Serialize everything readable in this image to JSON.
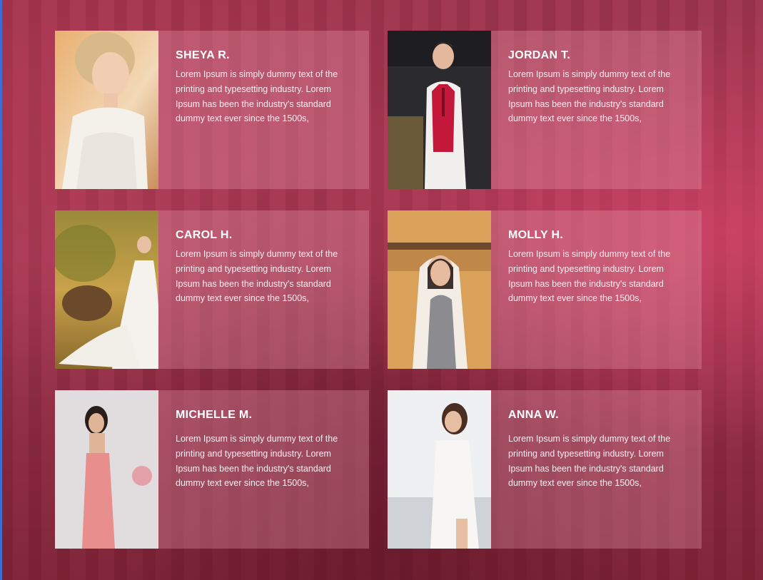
{
  "cards": [
    {
      "name": "SHEYA R.",
      "text": "Lorem Ipsum is simply dummy text of the printing and typesetting industry. Lorem Ipsum has been the industry's standard dummy text ever since the 1500s,",
      "photo": "bride-portrait-lace"
    },
    {
      "name": "JORDAN T.",
      "text": "Lorem Ipsum is simply dummy text of the printing and typesetting industry. Lorem Ipsum has been the industry's standard dummy text ever since the 1500s,",
      "photo": "groom-white-jacket"
    },
    {
      "name": "CAROL H.",
      "text": "Lorem Ipsum is simply dummy text of the printing and typesetting industry. Lorem Ipsum has been the industry's standard dummy text ever since the 1500s,",
      "photo": "bride-outdoor-field"
    },
    {
      "name": "MOLLY H.",
      "text": "Lorem Ipsum is simply dummy text of the printing and typesetting industry. Lorem Ipsum has been the industry's standard dummy text ever since the 1500s,",
      "photo": "woman-veil-glasses"
    },
    {
      "name": "MICHELLE M.",
      "text": "Lorem Ipsum is simply dummy text of the printing and typesetting industry. Lorem Ipsum has been the industry's standard dummy text ever since the 1500s,",
      "photo": "woman-pink-gown"
    },
    {
      "name": "ANNA W.",
      "text": "Lorem Ipsum is simply dummy text of the printing and typesetting industry. Lorem Ipsum has been the industry's standard dummy text ever since the 1500s,",
      "photo": "bride-runway-lace"
    }
  ]
}
